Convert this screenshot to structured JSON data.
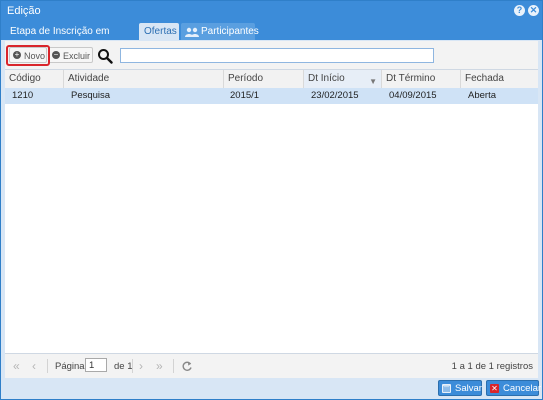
{
  "window": {
    "title": "Edição"
  },
  "titlebar_buttons": {
    "help_icon": "?",
    "close_icon": "✕"
  },
  "tabs": [
    {
      "label": "Etapa de Inscrição em Disciplina"
    },
    {
      "label": "Ofertas",
      "active": true
    },
    {
      "label": "Participantes",
      "icon": "people-icon"
    }
  ],
  "toolbar": {
    "new_label": "Novo",
    "delete_label": "Excluir",
    "search_value": ""
  },
  "grid": {
    "columns": [
      "Código",
      "Atividade",
      "Período",
      "Dt Início",
      "Dt Término",
      "Fechada"
    ],
    "sorted_column": "Dt Início",
    "rows": [
      {
        "codigo": "1210",
        "atividade": "Pesquisa",
        "periodo": "2015/1",
        "inicio": "23/02/2015",
        "termino": "04/09/2015",
        "fechada": "Aberta"
      }
    ]
  },
  "pager": {
    "page_label": "Página",
    "page_value": "1",
    "of_label": "de 1",
    "summary": "1 a 1 de 1 registros"
  },
  "footer": {
    "save_label": "Salvar",
    "cancel_label": "Cancelar"
  },
  "colors": {
    "accent": "#3c8cd9",
    "selected_row": "#cfe2f6",
    "highlight": "#d9252b"
  }
}
